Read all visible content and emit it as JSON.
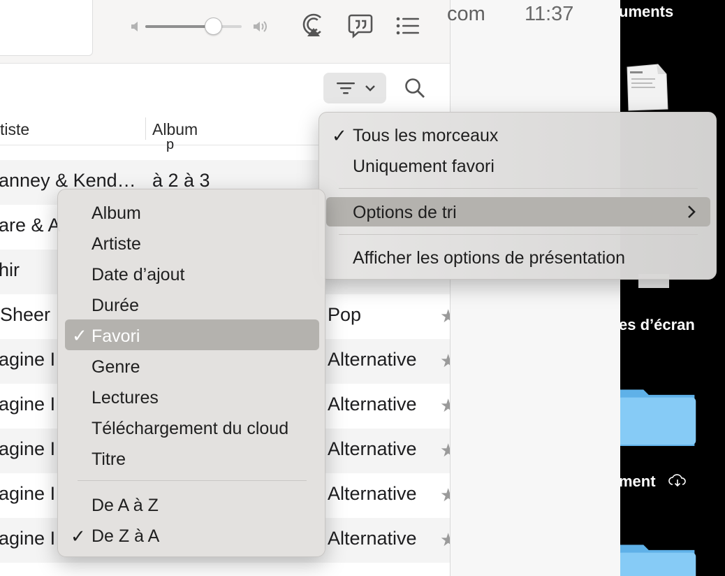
{
  "toolbar": {
    "volume_level": 0.7
  },
  "table": {
    "columns": [
      "tiste",
      "Album"
    ],
    "partial_row_text": "p",
    "rows": [
      {
        "artist": "anney & Kend…",
        "album": "à 2 à 3",
        "genre": ""
      },
      {
        "artist": "are & A",
        "album": "",
        "genre": ""
      },
      {
        "artist": "hir",
        "album": "",
        "genre": ""
      },
      {
        "artist": " Sheer",
        "album": "",
        "genre": "Pop"
      },
      {
        "artist": "agine I",
        "album": "",
        "genre": "Alternative"
      },
      {
        "artist": "agine I",
        "album": "",
        "genre": "Alternative"
      },
      {
        "artist": "agine I",
        "album": "",
        "genre": "Alternative"
      },
      {
        "artist": "agine I",
        "album": "",
        "genre": "Alternative"
      },
      {
        "artist": "agine I",
        "album": "",
        "genre": "Alternative"
      }
    ]
  },
  "menubar": {
    "text_fragment": "com",
    "clock": "11:37"
  },
  "desktop": {
    "labels": [
      "uments",
      "es d’écran",
      "ment"
    ]
  },
  "filter_menu": {
    "check_all": "✓",
    "all_tracks": "Tous les morceaux",
    "favorites_only": "Uniquement favori",
    "sort_options": "Options de tri",
    "show_view_options": "Afficher les options de présentation"
  },
  "sort_menu": {
    "items": [
      "Album",
      "Artiste",
      "Date d’ajout",
      "Durée",
      "Favori",
      "Genre",
      "Lectures",
      "Téléchargement du cloud",
      "Titre"
    ],
    "selected_check": "✓",
    "order_a_z": "De A à Z",
    "order_z_a": "De Z à A",
    "order_check": "✓"
  },
  "colors": {
    "menu_highlight": "#b4b2ae",
    "folder_blue": "#7cc4f2"
  }
}
